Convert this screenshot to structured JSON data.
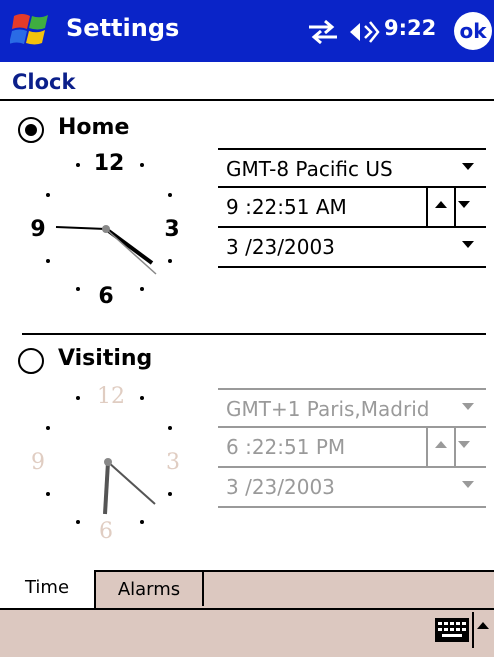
{
  "title_bar": {
    "app_title": "Settings",
    "time": "9:22",
    "ok_label": "ok",
    "colors": {
      "background": "#0a24c8",
      "text": "#ffffff"
    }
  },
  "page": {
    "heading": "Clock"
  },
  "home": {
    "label": "Home",
    "selected": true,
    "clock": {
      "hour_12": "12",
      "hour_3": "3",
      "hour_6": "6",
      "hour_9": "9",
      "time_shown": "9:22:51"
    },
    "timezone": "GMT-8 Pacific US",
    "time": "9 :22:51 AM",
    "date": "3 /23/2003"
  },
  "visiting": {
    "label": "Visiting",
    "selected": false,
    "clock": {
      "hour_12": "12",
      "hour_3": "3",
      "hour_6": "6",
      "hour_9": "9",
      "time_shown": "6:22:51"
    },
    "timezone": "GMT+1 Paris,Madrid",
    "time": "6 :22:51 PM",
    "date": "3 /23/2003"
  },
  "tabs": [
    {
      "label": "Time",
      "active": true
    },
    {
      "label": "Alarms",
      "active": false
    }
  ],
  "bottom_bar": {
    "icons": [
      "keyboard-icon",
      "input-panel-arrow-icon"
    ],
    "color": "#dcc8c0"
  }
}
